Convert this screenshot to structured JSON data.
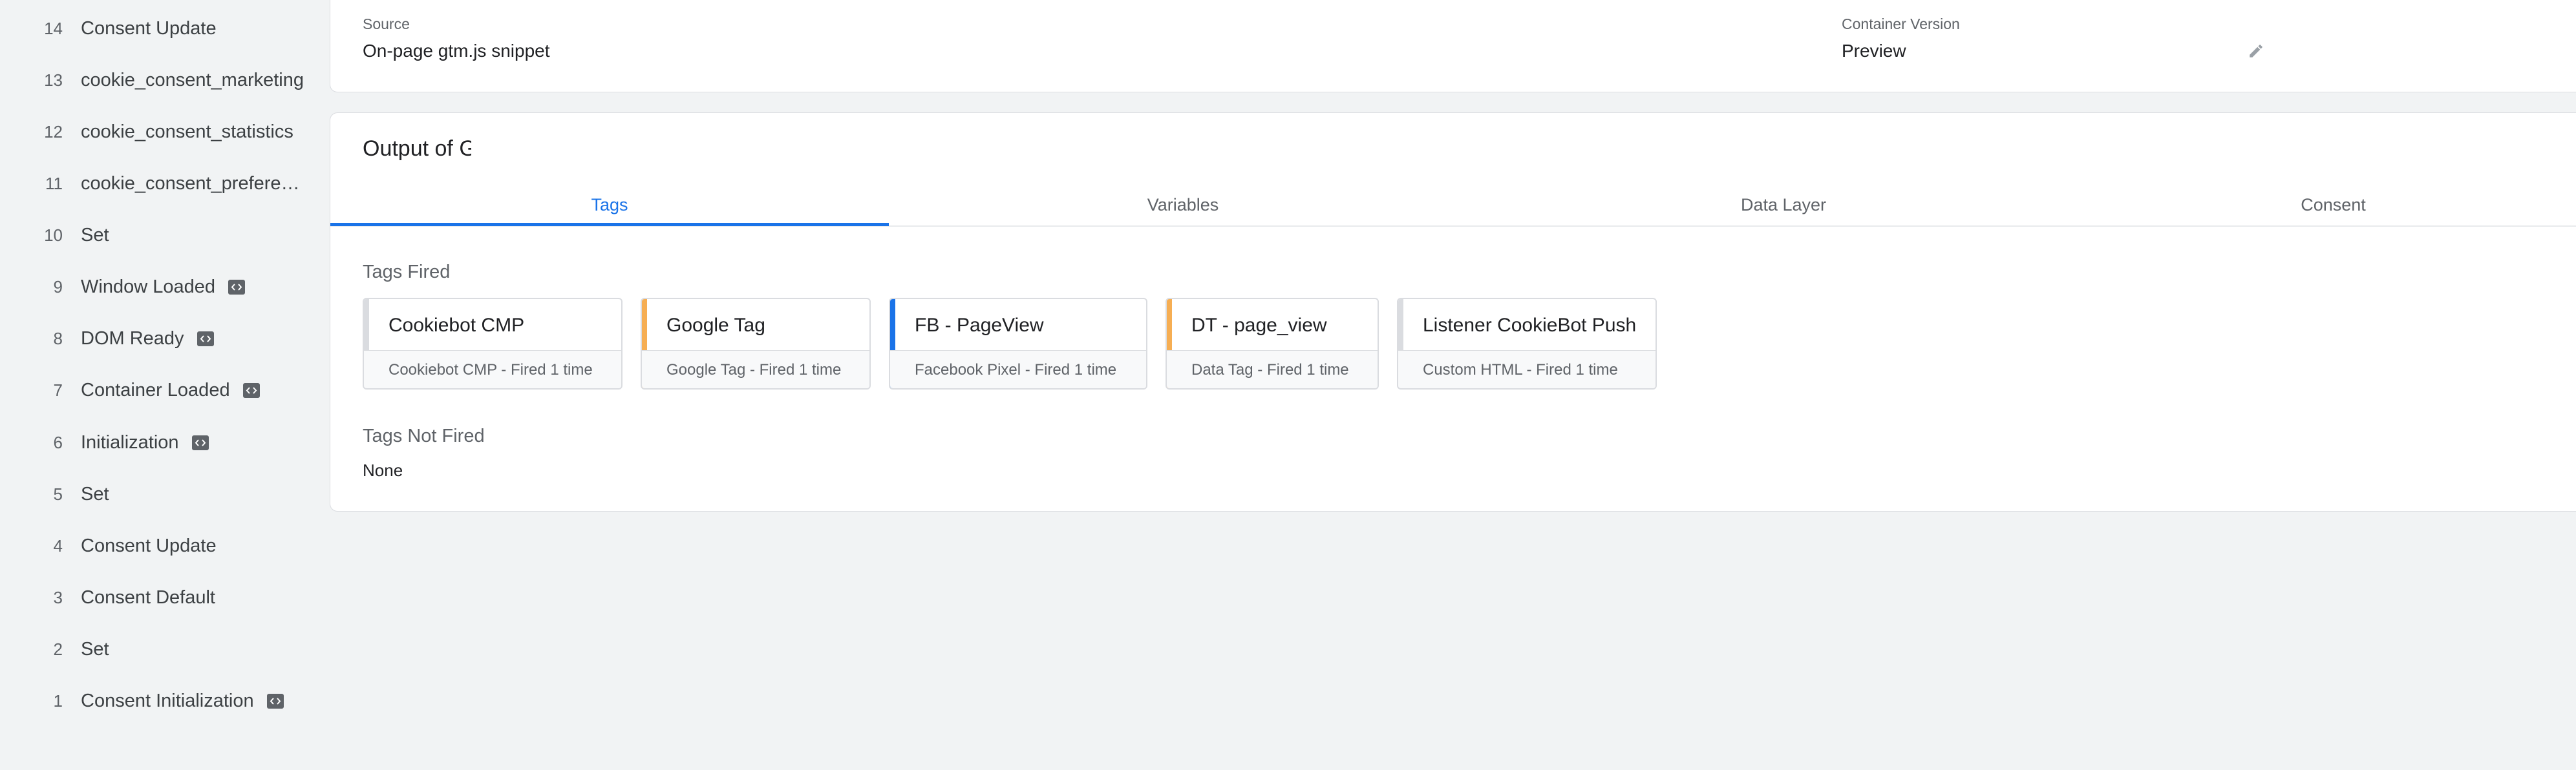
{
  "sidebar": {
    "items": [
      {
        "num": "14",
        "label": "Consent Update",
        "badge": false
      },
      {
        "num": "13",
        "label": "cookie_consent_marketing",
        "badge": false
      },
      {
        "num": "12",
        "label": "cookie_consent_statistics",
        "badge": false
      },
      {
        "num": "11",
        "label": "cookie_consent_preferences",
        "badge": false
      },
      {
        "num": "10",
        "label": "Set",
        "badge": false
      },
      {
        "num": "9",
        "label": "Window Loaded",
        "badge": true
      },
      {
        "num": "8",
        "label": "DOM Ready",
        "badge": true
      },
      {
        "num": "7",
        "label": "Container Loaded",
        "badge": true
      },
      {
        "num": "6",
        "label": "Initialization",
        "badge": true
      },
      {
        "num": "5",
        "label": "Set",
        "badge": false
      },
      {
        "num": "4",
        "label": "Consent Update",
        "badge": false
      },
      {
        "num": "3",
        "label": "Consent Default",
        "badge": false
      },
      {
        "num": "2",
        "label": "Set",
        "badge": false
      },
      {
        "num": "1",
        "label": "Consent Initialization",
        "badge": true
      }
    ]
  },
  "info": {
    "source_label": "Source",
    "source_value": "On-page gtm.js snippet",
    "version_label": "Container Version",
    "version_value": "Preview",
    "edit_icon": "pencil-icon"
  },
  "output": {
    "title": "Output of G",
    "tabs": [
      {
        "label": "Tags",
        "active": true
      },
      {
        "label": "Variables",
        "active": false
      },
      {
        "label": "Data Layer",
        "active": false
      },
      {
        "label": "Consent",
        "active": false
      }
    ],
    "fired_heading": "Tags Fired",
    "tags": [
      {
        "name": "Cookiebot CMP",
        "meta": "Cookiebot CMP - Fired 1 time",
        "accent": "#dadce0"
      },
      {
        "name": "Google Tag",
        "meta": "Google Tag - Fired 1 time",
        "accent": "#f6ae53"
      },
      {
        "name": "FB - PageView",
        "meta": "Facebook Pixel - Fired 1 time",
        "accent": "#1a73e8"
      },
      {
        "name": "DT - page_view",
        "meta": "Data Tag - Fired 1 time",
        "accent": "#f6ae53"
      },
      {
        "name": "Listener CookieBot Push",
        "meta": "Custom HTML - Fired 1 time",
        "accent": "#dadce0"
      }
    ],
    "not_fired_heading": "Tags Not Fired",
    "not_fired_value": "None"
  },
  "colors": {
    "accent_blue": "#1a73e8",
    "accent_orange": "#f6ae53",
    "background": "#f1f3f4"
  }
}
